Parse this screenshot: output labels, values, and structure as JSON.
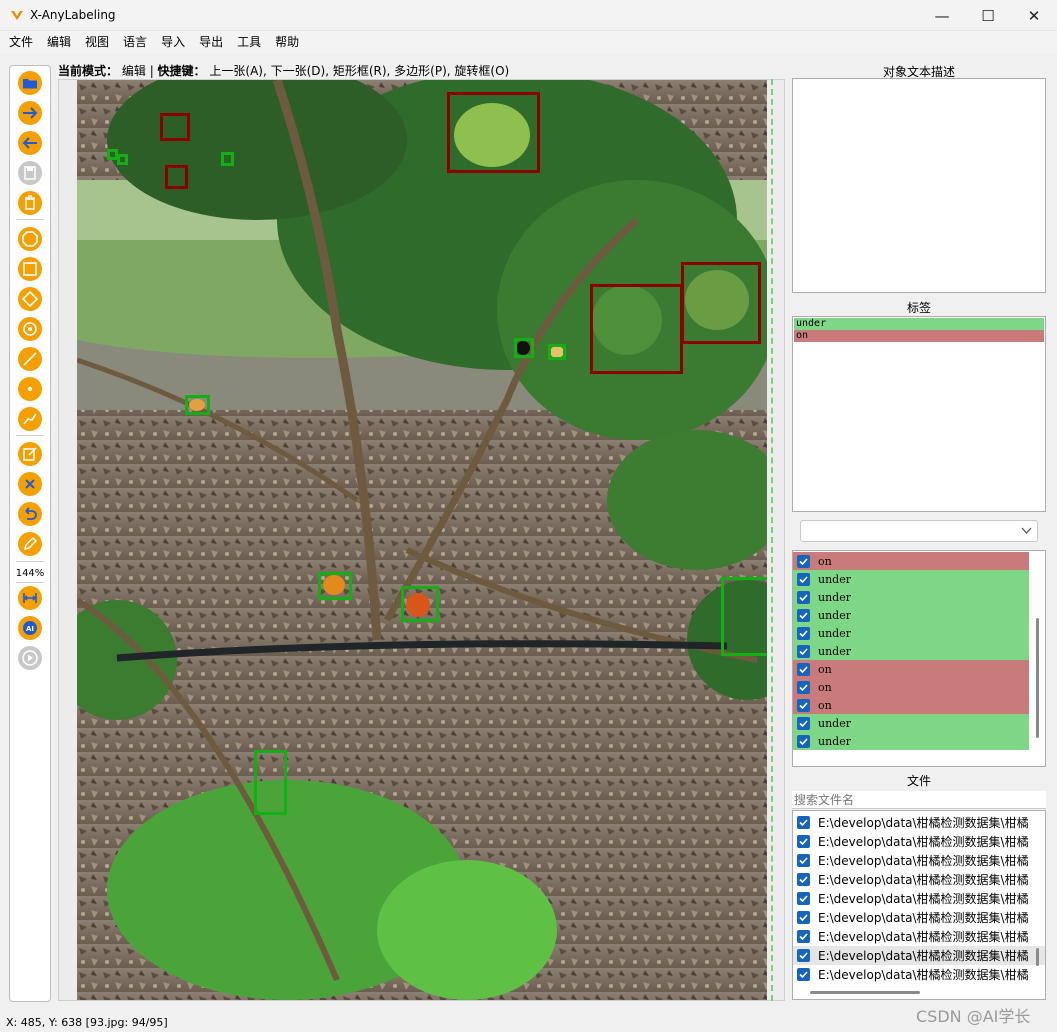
{
  "window": {
    "title": "X-AnyLabeling",
    "minimize": "—",
    "maximize": "☐",
    "close": "✕"
  },
  "menu": [
    "文件",
    "编辑",
    "视图",
    "语言",
    "导入",
    "导出",
    "工具",
    "帮助"
  ],
  "mode_bar": {
    "mode_label": "当前模式：",
    "mode_value": "编辑",
    "shortcut_label": "快捷键：",
    "shortcut_text": "上一张(A), 下一张(D), 矩形框(R), 多边形(P), 旋转框(O)"
  },
  "toolbar": {
    "zoom": "144%"
  },
  "panels": {
    "description_title": "对象文本描述",
    "labels_title": "标签",
    "files_title": "文件",
    "file_search_placeholder": "搜索文件名"
  },
  "label_list": [
    {
      "name": "under",
      "color": "#7ed687"
    },
    {
      "name": "on",
      "color": "#c97b7b"
    }
  ],
  "shape_list": [
    "on",
    "under",
    "under",
    "under",
    "under",
    "under",
    "on",
    "on",
    "on",
    "under",
    "under"
  ],
  "colors": {
    "on": "#c97b7b",
    "under": "#7ed687",
    "toolbar_icon": "#f5a000",
    "checkbox": "#1565c0"
  },
  "file_list": [
    "E:\\develop\\data\\柑橘检测数据集\\柑橘",
    "E:\\develop\\data\\柑橘检测数据集\\柑橘",
    "E:\\develop\\data\\柑橘检测数据集\\柑橘",
    "E:\\develop\\data\\柑橘检测数据集\\柑橘",
    "E:\\develop\\data\\柑橘检测数据集\\柑橘",
    "E:\\develop\\data\\柑橘检测数据集\\柑橘",
    "E:\\develop\\data\\柑橘检测数据集\\柑橘",
    "E:\\develop\\data\\柑橘检测数据集\\柑橘",
    "E:\\develop\\data\\柑橘检测数据集\\柑橘"
  ],
  "status": "X: 485, Y: 638 [93.jpg: 94/95]",
  "watermark": "CSDN @AI学长"
}
